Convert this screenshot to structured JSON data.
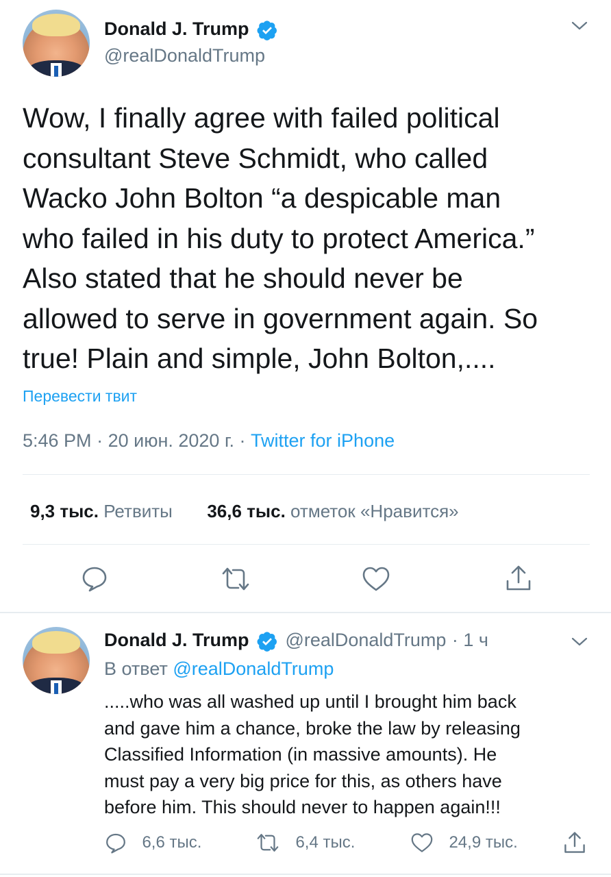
{
  "tweet": {
    "author_name": "Donald J. Trump",
    "author_handle": "@realDonaldTrump",
    "text_lines": [
      "Wow, I finally agree with failed political",
      "consultant Steve Schmidt, who called",
      "Wacko John Bolton “a despicable man",
      "who failed in his duty to protect America.”",
      "Also stated that he should never be",
      "allowed to serve in government again. So",
      "true! Plain and simple, John Bolton,...."
    ],
    "translate_label": "Перевести твит",
    "time": "5:46 PM",
    "date": "20 июн. 2020 г.",
    "separator": "·",
    "source": "Twitter for iPhone",
    "retweets_count": "9,3 тыс.",
    "retweets_label": "Ретвиты",
    "likes_count": "36,6 тыс.",
    "likes_label": "отметок «Нравится»"
  },
  "reply": {
    "author_name": "Donald J. Trump",
    "author_handle": "@realDonaldTrump",
    "age": "· 1 ч",
    "reply_prefix": "В ответ",
    "reply_to": "@realDonaldTrump",
    "text_lines": [
      ".....who was all washed up until I brought him back",
      "and gave him a chance, broke the law by releasing",
      "Classified Information (in massive amounts). He",
      "must pay a very big price for this, as others have",
      "before him. This should never to happen again!!!"
    ],
    "comments_count": "6,6 тыс.",
    "retweets_count": "6,4 тыс.",
    "likes_count": "24,9 тыс."
  },
  "colors": {
    "link": "#1da1f2",
    "secondary_text": "#657786",
    "divider": "#e6ecf0",
    "verified_badge": "#1da1f2"
  },
  "icons": {
    "verified": "verified-badge-icon",
    "menu": "chevron-down-icon",
    "reply": "comment-bubble-icon",
    "retweet": "retweet-icon",
    "like": "heart-icon",
    "share": "share-upload-icon"
  }
}
